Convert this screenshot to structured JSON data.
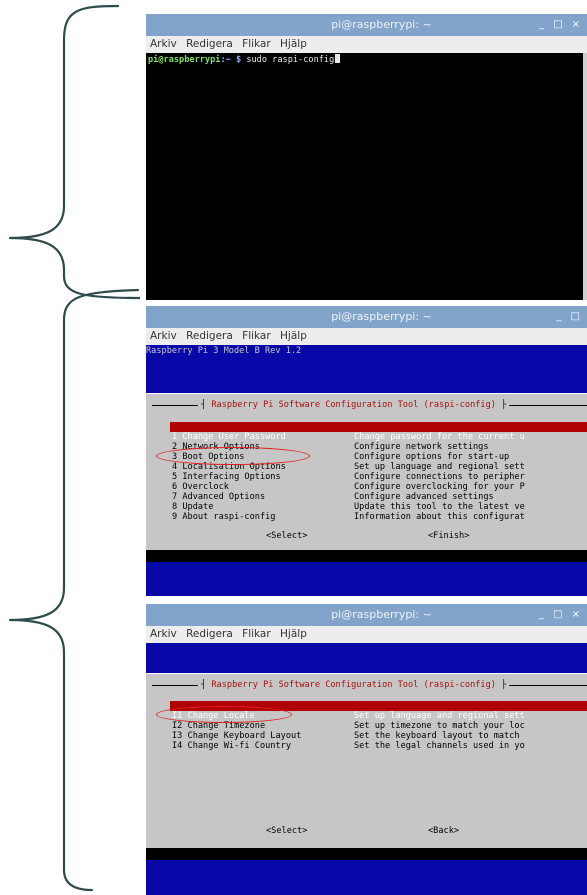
{
  "window_title": "pi@raspberrypi: ~",
  "window_controls": [
    "_",
    "□",
    "×"
  ],
  "menus": [
    "Arkiv",
    "Redigera",
    "Flikar",
    "Hjälp"
  ],
  "terminal": {
    "prompt_user": "pi@raspberrypi",
    "prompt_path": ":~ $",
    "command": " sudo raspi-config"
  },
  "raspi_header": "Raspberry Pi 3 Model B Rev 1.2",
  "dialog_title": "Raspberry Pi Software Configuration Tool (raspi-config)",
  "main_menu": [
    {
      "label": "1 Change User Password",
      "desc": "Change password for the current u"
    },
    {
      "label": "2 Network Options",
      "desc": "Configure network settings"
    },
    {
      "label": "3 Boot Options",
      "desc": "Configure options for start-up"
    },
    {
      "label": "4 Localisation Options",
      "desc": "Set up language and regional sett"
    },
    {
      "label": "5 Interfacing Options",
      "desc": "Configure connections to peripher"
    },
    {
      "label": "6 Overclock",
      "desc": "Configure overclocking for your P"
    },
    {
      "label": "7 Advanced Options",
      "desc": "Configure advanced settings"
    },
    {
      "label": "8 Update",
      "desc": "Update this tool to the latest ve"
    },
    {
      "label": "9 About raspi-config",
      "desc": "Information about this configurat"
    }
  ],
  "main_buttons": {
    "select": "<Select>",
    "finish": "<Finish>"
  },
  "localisation_menu": [
    {
      "label": "I1 Change Locale",
      "desc": "Set up language and regional sett"
    },
    {
      "label": "I2 Change Timezone",
      "desc": "Set up timezone to match your loc"
    },
    {
      "label": "I3 Change Keyboard Layout",
      "desc": "Set the keyboard layout to match"
    },
    {
      "label": "I4 Change Wi-fi Country",
      "desc": "Set the legal channels used in yo"
    }
  ],
  "localisation_buttons": {
    "select": "<Select>",
    "back": "<Back>"
  },
  "colors": {
    "titlebar": "#82a4cb",
    "terminal_bg": "#0808a8",
    "dialog_bg": "#c6c6c6",
    "selection": "#b00000",
    "highlight_ring": "#e02020",
    "brace": "#2f4b4b"
  }
}
